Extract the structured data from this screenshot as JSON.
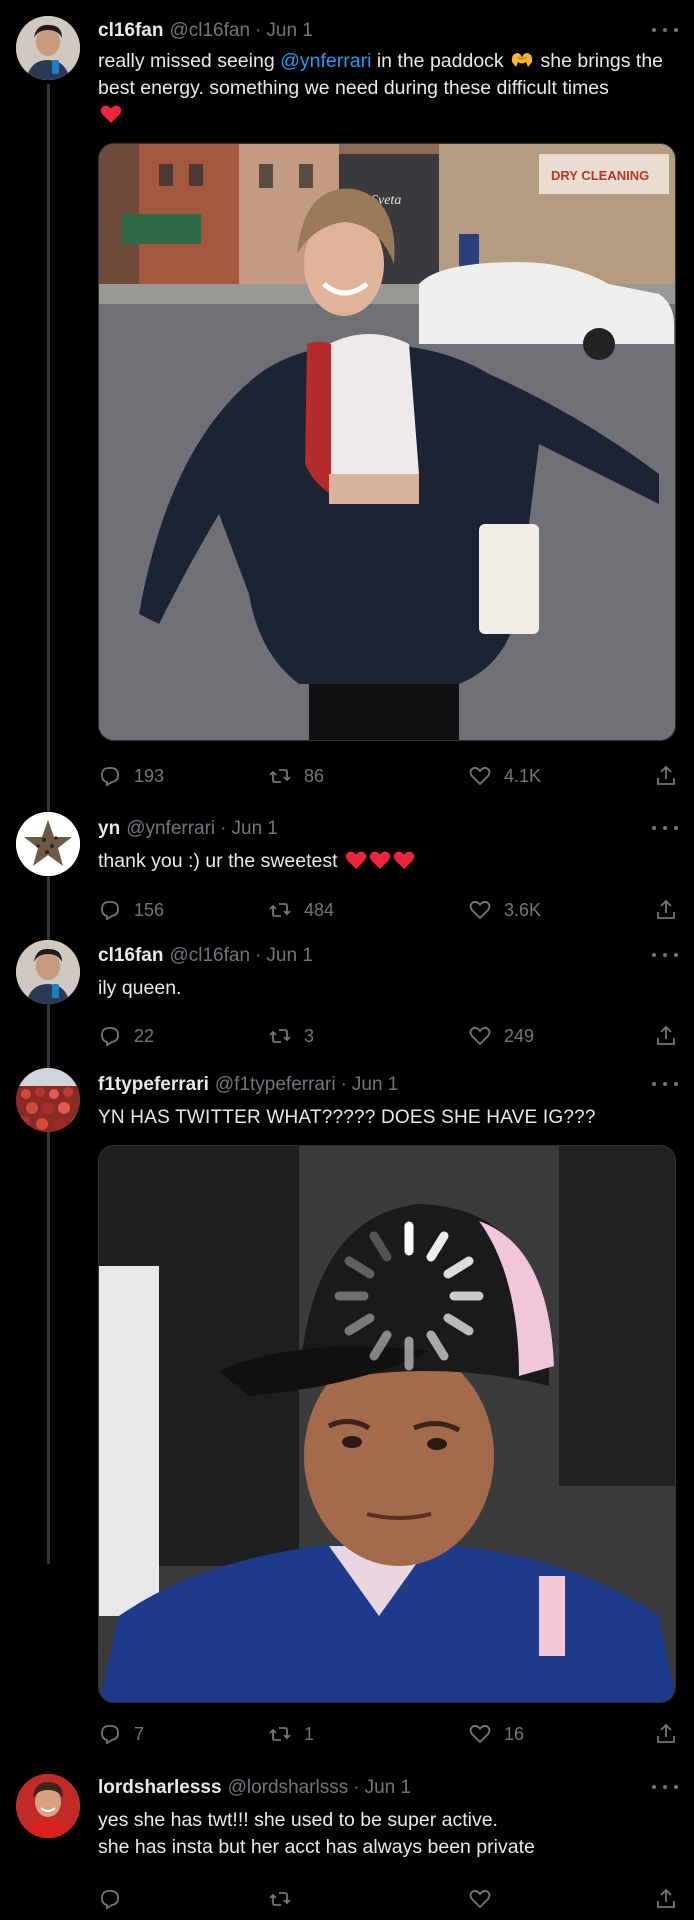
{
  "tweets": [
    {
      "name": "cl16fan",
      "handle": "@cl16fan",
      "time": "Jun 1",
      "text_before": "really missed seeing ",
      "mention": "@ynferrari",
      "text_after_1": " in the paddock ",
      "text_after_2": " she brings the best energy. something we need during these difficult times",
      "replies": "193",
      "retweets": "86",
      "likes": "4.1K"
    },
    {
      "name": "yn",
      "handle": "@ynferrari",
      "time": "Jun 1",
      "text": "thank you :) ur the sweetest",
      "replies": "156",
      "retweets": "484",
      "likes": "3.6K"
    },
    {
      "name": "cl16fan",
      "handle": "@cl16fan",
      "time": "Jun 1",
      "text": "ily queen.",
      "replies": "22",
      "retweets": "3",
      "likes": "249"
    },
    {
      "name": "f1typeferrari",
      "handle": "@f1typeferrari",
      "time": "Jun 1",
      "text": "YN HAS TWITTER WHAT????? DOES SHE HAVE IG???",
      "replies": "7",
      "retweets": "1",
      "likes": "16"
    },
    {
      "name": "lordsharlesss",
      "handle": "@lordsharlsss",
      "time": "Jun 1",
      "text_line1": "yes she has twt!!! she used to be super active.",
      "text_line2": "she has insta but her acct has always been private",
      "replies": "",
      "retweets": "",
      "likes": ""
    }
  ],
  "separator": "·",
  "media_signs": {
    "shop_sign": "DRY CLEANING",
    "cafe_sign": "Sveta"
  },
  "colors": {
    "background": "#000000",
    "text": "#e7e9ea",
    "secondary": "#71767b",
    "link": "#1d9bf0",
    "heart": "#f91880",
    "thread_line": "#333639"
  }
}
